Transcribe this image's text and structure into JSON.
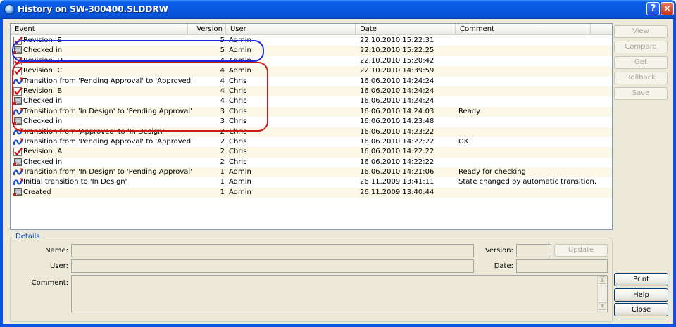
{
  "window": {
    "title": "History on SW-300400.SLDDRW"
  },
  "titlebar": {
    "help_label": "?",
    "close_label": "×"
  },
  "columns": {
    "event": "Event",
    "version": "Version",
    "user": "User",
    "date": "Date",
    "comment": "Comment"
  },
  "rows": [
    {
      "icon": "revision",
      "event": "Revision: E",
      "version": "5",
      "user": "Admin",
      "date": "22.10.2010 15:22:31",
      "comment": ""
    },
    {
      "icon": "checkin",
      "event": "Checked in",
      "version": "5",
      "user": "Admin",
      "date": "22.10.2010 15:22:25",
      "comment": ""
    },
    {
      "icon": "revision",
      "event": "Revision: D",
      "version": "4",
      "user": "Admin",
      "date": "22.10.2010 15:20:42",
      "comment": ""
    },
    {
      "icon": "revision",
      "event": "Revision: C",
      "version": "4",
      "user": "Admin",
      "date": "22.10.2010 14:39:59",
      "comment": ""
    },
    {
      "icon": "transition",
      "event": "Transition from 'Pending Approval' to 'Approved'",
      "version": "4",
      "user": "Chris",
      "date": "16.06.2010 14:24:24",
      "comment": ""
    },
    {
      "icon": "revision",
      "event": "Revision: B",
      "version": "4",
      "user": "Chris",
      "date": "16.06.2010 14:24:24",
      "comment": ""
    },
    {
      "icon": "checkin",
      "event": "Checked in",
      "version": "4",
      "user": "Chris",
      "date": "16.06.2010 14:24:24",
      "comment": ""
    },
    {
      "icon": "transition",
      "event": "Transition from 'In Design' to 'Pending Approval'",
      "version": "3",
      "user": "Chris",
      "date": "16.06.2010 14:24:03",
      "comment": "Ready"
    },
    {
      "icon": "checkin",
      "event": "Checked in",
      "version": "3",
      "user": "Chris",
      "date": "16.06.2010 14:23:48",
      "comment": ""
    },
    {
      "icon": "transition",
      "event": "Transition from 'Approved' to 'In Design'",
      "version": "2",
      "user": "Chris",
      "date": "16.06.2010 14:23:22",
      "comment": ""
    },
    {
      "icon": "transition",
      "event": "Transition from 'Pending Approval' to 'Approved'",
      "version": "2",
      "user": "Chris",
      "date": "16.06.2010 14:22:22",
      "comment": "OK"
    },
    {
      "icon": "revision",
      "event": "Revision: A",
      "version": "2",
      "user": "Chris",
      "date": "16.06.2010 14:22:22",
      "comment": ""
    },
    {
      "icon": "checkin",
      "event": "Checked in",
      "version": "2",
      "user": "Chris",
      "date": "16.06.2010 14:22:22",
      "comment": ""
    },
    {
      "icon": "transition",
      "event": "Transition from 'In Design' to 'Pending Approval'",
      "version": "1",
      "user": "Admin",
      "date": "16.06.2010 14:21:06",
      "comment": "Ready for checking"
    },
    {
      "icon": "transition",
      "event": "Initial transition to 'In Design'",
      "version": "1",
      "user": "Admin",
      "date": "26.11.2009 13:41:11",
      "comment": "State changed by automatic transition."
    },
    {
      "icon": "checkin",
      "event": "Created",
      "version": "1",
      "user": "Admin",
      "date": "26.11.2009 13:40:44",
      "comment": ""
    }
  ],
  "side_buttons": {
    "view": "View",
    "compare": "Compare",
    "get": "Get",
    "rollback": "Rollback",
    "save": "Save"
  },
  "bottom_buttons": {
    "print": "Print",
    "help": "Help",
    "close": "Close"
  },
  "details": {
    "legend": "Details",
    "name_label": "Name:",
    "user_label": "User:",
    "comment_label": "Comment:",
    "version_label": "Version:",
    "date_label": "Date:",
    "update_label": "Update",
    "name_value": "",
    "user_value": "",
    "comment_value": "",
    "version_value": "",
    "date_value": ""
  },
  "annotations": {
    "blue": "#1d2ad6",
    "red": "#d01818"
  },
  "icons": {
    "revision": "revision-check-icon",
    "checkin": "checkin-icon",
    "transition": "transition-icon"
  }
}
